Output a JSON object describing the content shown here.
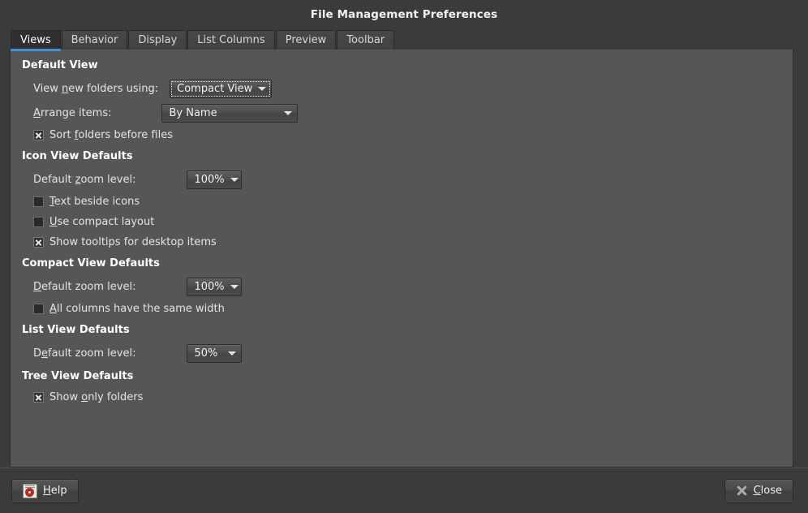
{
  "window": {
    "title": "File Management Preferences"
  },
  "tabs": [
    {
      "label": "Views",
      "selected": true
    },
    {
      "label": "Behavior",
      "selected": false
    },
    {
      "label": "Display",
      "selected": false
    },
    {
      "label": "List Columns",
      "selected": false
    },
    {
      "label": "Preview",
      "selected": false
    },
    {
      "label": "Toolbar",
      "selected": false
    }
  ],
  "accent_color": "#3d90d7",
  "sections": {
    "default_view": {
      "title": "Default View",
      "view_new_folders_label": "View new folders using:",
      "view_new_folders_value": "Compact View",
      "arrange_items_label": "Arrange items:",
      "arrange_items_value": "By Name",
      "sort_folders_label": "Sort folders before files",
      "sort_folders_checked": true
    },
    "icon_view": {
      "title": "Icon View Defaults",
      "zoom_label": "Default zoom level:",
      "zoom_value": "100%",
      "text_beside_icons_label": "Text beside icons",
      "text_beside_icons_checked": false,
      "compact_layout_label": "Use compact layout",
      "compact_layout_checked": false,
      "tooltips_label": "Show tooltips for desktop items",
      "tooltips_checked": true
    },
    "compact_view": {
      "title": "Compact View Defaults",
      "zoom_label": "Default zoom level:",
      "zoom_value": "100%",
      "same_width_label": "All columns have the same width",
      "same_width_checked": false
    },
    "list_view": {
      "title": "List View Defaults",
      "zoom_label": "Default zoom level:",
      "zoom_value": "50%"
    },
    "tree_view": {
      "title": "Tree View Defaults",
      "show_only_folders_label": "Show only folders",
      "show_only_folders_checked": true
    }
  },
  "actions": {
    "help_label": "Help",
    "close_label": "Close"
  }
}
